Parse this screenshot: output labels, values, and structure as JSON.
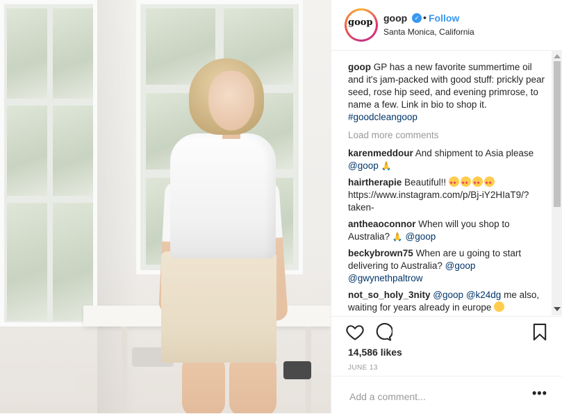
{
  "header": {
    "avatar_text": "goop",
    "username": "goop",
    "follow_label": "Follow",
    "location": "Santa Monica, California"
  },
  "caption": {
    "username": "goop",
    "text": "GP has a new favorite summertime oil and it's jam-packed with good stuff: prickly pear seed, rose hip seed, and evening primrose, to name a few. Link in bio to shop it.",
    "hashtag": "#goodcleangoop"
  },
  "load_more_label": "Load more comments",
  "comments": [
    {
      "username": "karenmeddour",
      "text": "And shipment to Asia please",
      "mention": "@goop"
    },
    {
      "username": "hairtherapie",
      "text": "Beautiful!!",
      "text2": "https://www.instagram.com/p/Bj-iY2HIaT9/?taken-"
    },
    {
      "username": "antheaoconnor",
      "text": "When will you shop to Australia?",
      "mention": "@goop"
    },
    {
      "username": "beckybrown75",
      "text": "When are u going to start delivering to Australia?",
      "mention": "@goop",
      "mention2": "@gwynethpaltrow"
    },
    {
      "username": "not_so_holy_3nity",
      "mention": "@goop",
      "mention2": "@k24dg",
      "text": "me also, waiting for years already in europe"
    }
  ],
  "likes": "14,586 likes",
  "date": "JUNE 13",
  "add_comment": {
    "placeholder": "Add a comment..."
  },
  "more_label": "•••",
  "icons": {
    "heart": "heart-icon",
    "comment": "comment-icon",
    "bookmark": "bookmark-icon",
    "verified": "verified-badge-icon"
  },
  "colors": {
    "link": "#3897f0",
    "mention": "#003569",
    "muted": "#999999"
  }
}
